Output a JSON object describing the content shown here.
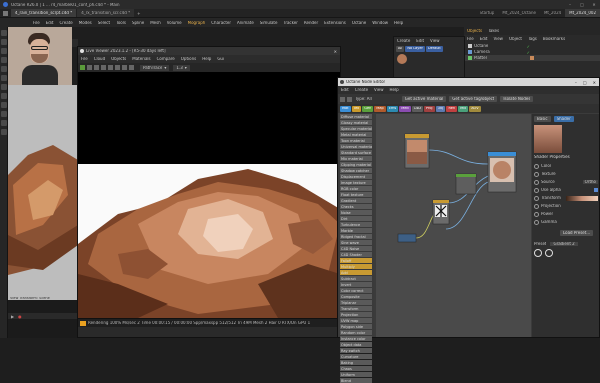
{
  "window": {
    "title": "Octane R26.0 | 1 ... r4_marble01_conf_ph.c4d * - Main",
    "tabs": [
      "4_rain_transition_scrpt.c4d *",
      "4_rx_transition_scr.c4d *"
    ],
    "layouts": [
      "Startup",
      "Mt_2024_Octane",
      "Mt_2024",
      "Mt_2024_002"
    ]
  },
  "main_menu": [
    "File",
    "Edit",
    "Create",
    "Modes",
    "Select",
    "Tools",
    "Spline",
    "Mesh",
    "Volume",
    "Mograph",
    "Character",
    "Animate",
    "Simulate",
    "Tracker",
    "Render",
    "Extensions",
    "Octane",
    "Window",
    "Help"
  ],
  "viewport_left": {
    "menu": [
      "View",
      "Cameras",
      "Display",
      "Options",
      "Filter",
      "Panel"
    ],
    "header": "Node Settings",
    "header2": "Texture Viewer",
    "footer": "View Transform: Scene"
  },
  "render_window": {
    "title": "Live Viewer 2023.1.2 - [R5-30 days left]",
    "menu": [
      "File",
      "Cloud",
      "Objects",
      "Materials",
      "Compare",
      "Options",
      "Help",
      "Gui"
    ],
    "mode": "PathTrace",
    "zoom": "1.3",
    "status": "Rendering 100%   Ms/sec 2   Time 00:00:15 / 00:00:00   Spp/maxspp 512/512   Tri 49M   Mesh 2   Hair 0   RTX/On   GPU 1"
  },
  "node_editor": {
    "title": "Octane Node Editor",
    "menu": [
      "Edit",
      "Create",
      "View",
      "Help"
    ],
    "type_label": "Type: All",
    "buttons": [
      "Get active material",
      "Get active tag/object",
      "Isolate Nodes"
    ],
    "chips": [
      {
        "label": "Mat",
        "color": "#3a8ed6"
      },
      {
        "label": "Tex",
        "color": "#c99a2c"
      },
      {
        "label": "Gen",
        "color": "#5aa03c"
      },
      {
        "label": "Map",
        "color": "#b05a2c"
      },
      {
        "label": "Ems",
        "color": "#2c8ab0"
      },
      {
        "label": "Med",
        "color": "#8a4cb0"
      },
      {
        "label": "C4D",
        "color": "#5c5c5c"
      },
      {
        "label": "Proj",
        "color": "#a04040"
      },
      {
        "label": "Obj",
        "color": "#5c7ab0"
      },
      {
        "label": "Ren",
        "color": "#c04040"
      },
      {
        "label": "Mix",
        "color": "#4aa07a"
      },
      {
        "label": "AOV",
        "color": "#a08a3c"
      }
    ],
    "node_list": [
      "Diffuse material",
      "Glossy material",
      "Specular material",
      "Metal material",
      "Toon material",
      "Universal material",
      "Standard surface",
      "Mix material",
      "Clipping material",
      "Shadow catcher",
      "Displacement",
      "Image texture",
      "RGB color",
      "Float texture",
      "Gradient",
      "Checks",
      "Noise",
      "Dirt",
      "Turbulence",
      "Marble",
      "Ridged fractal",
      "Sine wave",
      "C4D Noise",
      "C4D Shader",
      "Falloff",
      "Multiply",
      "Add",
      "Subtract",
      "Invert",
      "Color correct",
      "Composite",
      "Triplanar",
      "Transform",
      "Projection",
      "UVW map",
      "Polygon side",
      "Random color",
      "Instance color",
      "Object data",
      "Ray switch",
      "Curvature",
      "Baking",
      "Chaos",
      "Uniform",
      "Blend"
    ],
    "node_list_colors": [
      "#5a5a5a",
      "#5a5a5a",
      "#5a5a5a",
      "#5a5a5a",
      "#5a5a5a",
      "#5a5a5a",
      "#5a5a5a",
      "#5a5a5a",
      "#5a5a5a",
      "#5a5a5a",
      "#5a5a5a",
      "#5a5a5a",
      "#5a5a5a",
      "#5a5a5a",
      "#5a5a5a",
      "#5a5a5a",
      "#5a5a5a",
      "#5a5a5a",
      "#5a5a5a",
      "#5a5a5a",
      "#5a5a5a",
      "#5a5a5a",
      "#5a5a5a",
      "#5a5a5a",
      "#c89a32",
      "#c89a32",
      "#c89a32",
      "#5a5a5a",
      "#5a5a5a",
      "#5a5a5a",
      "#5a5a5a",
      "#5a5a5a",
      "#5a5a5a",
      "#5a5a5a",
      "#5a5a5a",
      "#5a5a5a",
      "#5a5a5a",
      "#5a5a5a",
      "#5a5a5a",
      "#5a5a5a",
      "#5a5a5a",
      "#5a5a5a",
      "#5a5a5a",
      "#5a5a5a",
      "#5a5a5a"
    ],
    "properties": {
      "tabs": [
        "Basic",
        "Shader"
      ],
      "section": "Shader Properties",
      "rows": [
        "Color",
        "Texture",
        "Source",
        "Use alpha",
        "Transform",
        "Projection",
        "Power",
        "Gamma"
      ],
      "values": [
        "",
        "",
        "Ortho",
        "",
        "",
        "",
        "",
        ""
      ],
      "load_button": "Load Preset...",
      "preset_label": "Preset",
      "preset_value": "Gradient 2"
    }
  },
  "material_manager": {
    "menu": [
      "Create",
      "Edit",
      "View"
    ],
    "filters": [
      "All",
      "No Layer",
      "Default"
    ]
  },
  "object_manager": {
    "tabs": [
      "Objects",
      "Takes"
    ],
    "menu": [
      "File",
      "Edit",
      "View",
      "Object",
      "Tags",
      "Bookmarks"
    ],
    "items": [
      "Octane",
      "Camera",
      "Platter"
    ],
    "badge_value": "6"
  }
}
